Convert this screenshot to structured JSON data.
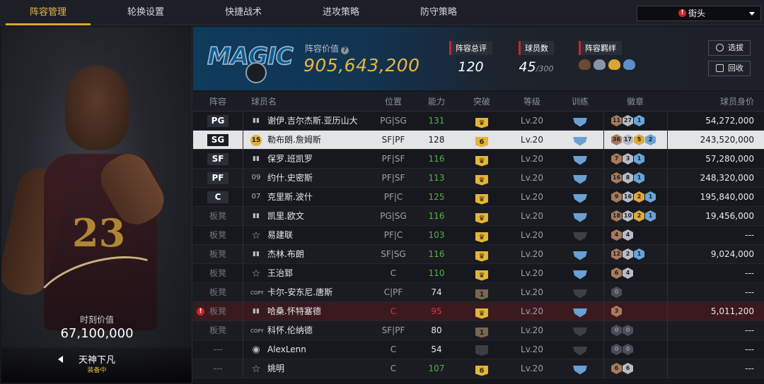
{
  "nav": {
    "tabs": [
      "阵容管理",
      "轮换设置",
      "快捷战术",
      "进攻策略",
      "防守策略"
    ],
    "active_tab": 0,
    "region": "街头"
  },
  "card": {
    "jersey_number": "23",
    "value_label": "时刻价值",
    "value": "67,100,000",
    "skin_name": "天神下凡",
    "equip_status": "装备中"
  },
  "team": {
    "logo_text": "MAGIC",
    "value_label": "阵容价值",
    "value": "905,643,200",
    "rating_label": "阵容总评",
    "rating": "120",
    "players_label": "球员数",
    "players": "45",
    "players_max": "/300",
    "chem_label": "阵容羁绊",
    "btn_pick": "选拔",
    "btn_recycle": "回收"
  },
  "table": {
    "headers": [
      "阵容",
      "球员名",
      "位置",
      "能力",
      "突破",
      "等级",
      "训练",
      "徽章",
      "球员身价"
    ],
    "rows": [
      {
        "slot": "PG",
        "icon": "bars",
        "name": "谢伊.吉尔杰斯.亚历山大",
        "pos": "PG|SG",
        "ability": "131",
        "ab_color": "g",
        "break": "crown",
        "level": "Lv.20",
        "train": true,
        "badges": [
          [
            "b",
            "11"
          ],
          [
            "s",
            "27"
          ],
          [
            "h",
            "1"
          ]
        ],
        "price": "54,272,000"
      },
      {
        "slot": "SG",
        "icon": "numb",
        "icon_text": "15",
        "name": "勒布朗.詹姆斯",
        "pos": "SF|PF",
        "ability": "128",
        "ab_color": "w",
        "break": "six",
        "break_text": "6",
        "level": "Lv.20",
        "train": true,
        "badges": [
          [
            "b",
            "36"
          ],
          [
            "s",
            "17"
          ],
          [
            "gd",
            "5"
          ],
          [
            "h",
            "2"
          ]
        ],
        "price": "243,520,000",
        "selected": true
      },
      {
        "slot": "SF",
        "icon": "bars",
        "name": "保罗.班凯罗",
        "pos": "PF|SF",
        "ability": "116",
        "ab_color": "g",
        "break": "crown",
        "level": "Lv.20",
        "train": true,
        "badges": [
          [
            "b",
            "7"
          ],
          [
            "s",
            "3"
          ],
          [
            "h",
            "1"
          ]
        ],
        "price": "57,280,000"
      },
      {
        "slot": "PF",
        "icon": "num",
        "icon_text": "09",
        "name": "约什.史密斯",
        "pos": "PF|SF",
        "ability": "113",
        "ab_color": "g",
        "break": "crown",
        "level": "Lv.20",
        "train": true,
        "badges": [
          [
            "b",
            "16"
          ],
          [
            "s",
            "8"
          ],
          [
            "h",
            "1"
          ]
        ],
        "price": "248,320,000"
      },
      {
        "slot": "C",
        "icon": "num",
        "icon_text": "07",
        "name": "克里斯.波什",
        "pos": "PF|C",
        "ability": "125",
        "ab_color": "g",
        "break": "crown",
        "level": "Lv.20",
        "train": true,
        "badges": [
          [
            "b",
            "9"
          ],
          [
            "s",
            "16"
          ],
          [
            "gd",
            "2"
          ],
          [
            "h",
            "1"
          ]
        ],
        "price": "195,840,000"
      },
      {
        "slot": "板凳",
        "icon": "bars",
        "name": "凯里.欧文",
        "pos": "PG|SG",
        "ability": "116",
        "ab_color": "g",
        "break": "crown",
        "level": "Lv.20",
        "train": true,
        "badges": [
          [
            "b",
            "18"
          ],
          [
            "s",
            "10"
          ],
          [
            "gd",
            "2"
          ],
          [
            "h",
            "1"
          ]
        ],
        "price": "19,456,000"
      },
      {
        "slot": "板凳",
        "icon": "star",
        "name": "易建联",
        "pos": "PF|C",
        "ability": "103",
        "ab_color": "g",
        "break": "crown",
        "level": "Lv.20",
        "train": false,
        "badges": [
          [
            "b",
            "4"
          ],
          [
            "s",
            "4"
          ]
        ],
        "price": "---"
      },
      {
        "slot": "板凳",
        "icon": "bars",
        "name": "杰林.布朗",
        "pos": "SF|SG",
        "ability": "116",
        "ab_color": "g",
        "break": "crown",
        "level": "Lv.20",
        "train": true,
        "badges": [
          [
            "b",
            "12"
          ],
          [
            "s",
            "2"
          ],
          [
            "h",
            "1"
          ]
        ],
        "price": "9,024,000"
      },
      {
        "slot": "板凳",
        "icon": "star",
        "name": "王治郅",
        "pos": "C",
        "ability": "110",
        "ab_color": "g",
        "break": "crown",
        "level": "Lv.20",
        "train": true,
        "badges": [
          [
            "b",
            "6"
          ],
          [
            "s",
            "4"
          ]
        ],
        "price": "---"
      },
      {
        "slot": "板凳",
        "icon": "copy",
        "icon_text": "COPY",
        "name": "卡尔-安东尼.唐斯",
        "pos": "C|PF",
        "ability": "74",
        "ab_color": "w",
        "break": "one",
        "break_text": "1",
        "level": "Lv.20",
        "train": false,
        "badges": [
          [
            "d",
            "0"
          ]
        ],
        "price": "---"
      },
      {
        "slot": "板凳",
        "icon": "bars",
        "name": "哈桑.怀特塞德",
        "pos": "C",
        "ability": "95",
        "ab_color": "g",
        "break": "crown",
        "level": "Lv.20",
        "train": true,
        "badges": [
          [
            "b",
            "3"
          ]
        ],
        "price": "5,011,200",
        "warning": true
      },
      {
        "slot": "板凳",
        "icon": "copy",
        "icon_text": "COPY",
        "name": "科怀.伦纳德",
        "pos": "SF|PF",
        "ability": "80",
        "ab_color": "w",
        "break": "one",
        "break_text": "1",
        "level": "Lv.20",
        "train": false,
        "badges": [
          [
            "d",
            "0"
          ],
          [
            "d",
            "0"
          ]
        ],
        "price": "---"
      },
      {
        "slot": "---",
        "icon": "person",
        "name": "AlexLenn",
        "pos": "C",
        "ability": "54",
        "ab_color": "w",
        "break": "dash",
        "level": "Lv.20",
        "train": false,
        "badges": [
          [
            "d",
            "0"
          ],
          [
            "d",
            "0"
          ]
        ],
        "price": "---"
      },
      {
        "slot": "---",
        "icon": "star",
        "name": "姚明",
        "pos": "C",
        "ability": "107",
        "ab_color": "g",
        "break": "six",
        "break_text": "6",
        "level": "Lv.20",
        "train": true,
        "badges": [
          [
            "b",
            "6"
          ],
          [
            "s",
            "6"
          ]
        ],
        "price": "---"
      }
    ]
  }
}
